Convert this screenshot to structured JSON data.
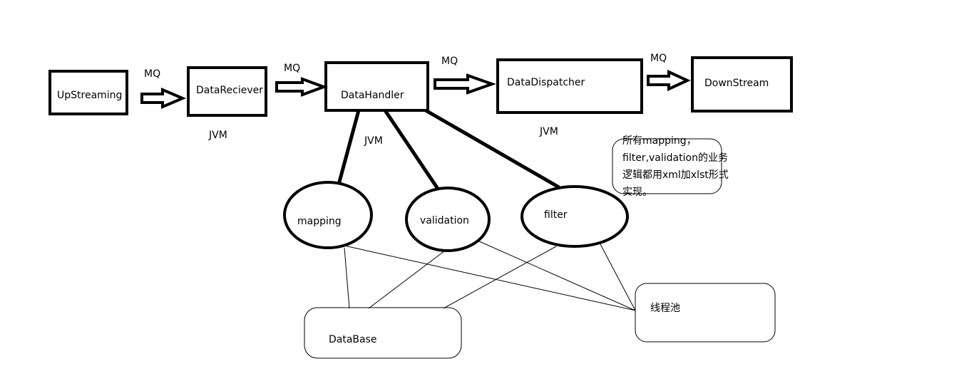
{
  "nodes": {
    "upstreaming": "UpStreaming",
    "datareciever": "DataReciever",
    "datahandler": "DataHandler",
    "datadispatcher": "DataDispatcher",
    "downstream": "DownStream",
    "mapping": "mapping",
    "validation": "validation",
    "filter": "filter",
    "database": "DataBase",
    "threadpool": "线程池"
  },
  "edge_labels": {
    "mq1": "MQ",
    "mq2": "MQ",
    "mq3": "MQ",
    "mq4": "MQ",
    "jvm1": "JVM",
    "jvm2": "JVM",
    "jvm3": "JVM"
  },
  "note": "所有mapping，filter,validation的业务逻辑都用xml加xlst形式实现。"
}
